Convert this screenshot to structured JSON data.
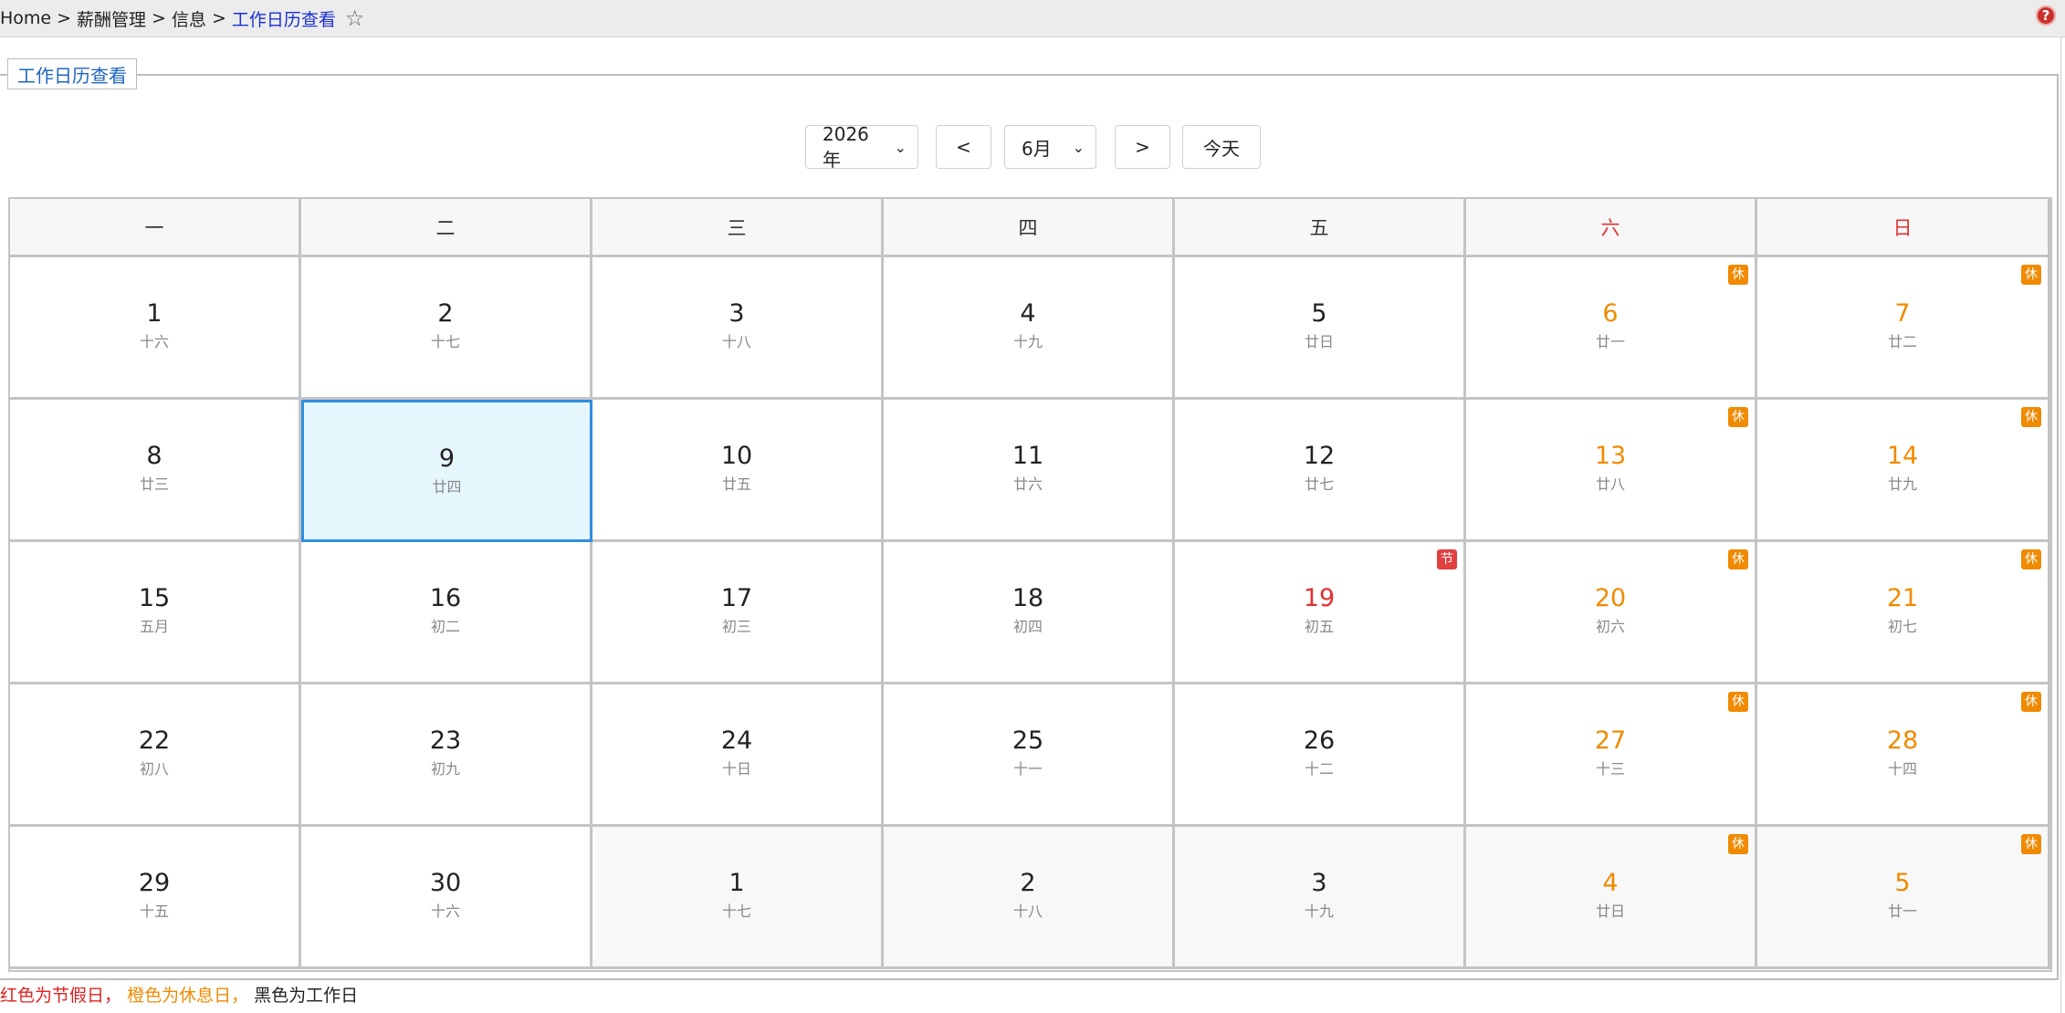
{
  "breadcrumb": {
    "items": [
      "Home",
      "薪酬管理",
      "信息"
    ],
    "separator": ">",
    "current": "工作日历查看",
    "favorite_icon": "star-outline-icon"
  },
  "help": {
    "icon": "help-icon",
    "glyph": "?"
  },
  "panel": {
    "legend": "工作日历查看"
  },
  "controls": {
    "year_value": "2026年",
    "prev_label": "<",
    "month_value": "6月",
    "next_label": ">",
    "today_label": "今天"
  },
  "weekdays": [
    "一",
    "二",
    "三",
    "四",
    "五",
    "六",
    "日"
  ],
  "weeks": [
    [
      {
        "day": "1",
        "lunar": "十六",
        "kind": "work"
      },
      {
        "day": "2",
        "lunar": "十七",
        "kind": "work"
      },
      {
        "day": "3",
        "lunar": "十八",
        "kind": "work"
      },
      {
        "day": "4",
        "lunar": "十九",
        "kind": "work"
      },
      {
        "day": "5",
        "lunar": "廿日",
        "kind": "work"
      },
      {
        "day": "6",
        "lunar": "廿一",
        "kind": "rest",
        "badge": "休"
      },
      {
        "day": "7",
        "lunar": "廿二",
        "kind": "rest",
        "badge": "休"
      }
    ],
    [
      {
        "day": "8",
        "lunar": "廿三",
        "kind": "work"
      },
      {
        "day": "9",
        "lunar": "廿四",
        "kind": "work",
        "today": true
      },
      {
        "day": "10",
        "lunar": "廿五",
        "kind": "work"
      },
      {
        "day": "11",
        "lunar": "廿六",
        "kind": "work"
      },
      {
        "day": "12",
        "lunar": "廿七",
        "kind": "work"
      },
      {
        "day": "13",
        "lunar": "廿八",
        "kind": "rest",
        "badge": "休"
      },
      {
        "day": "14",
        "lunar": "廿九",
        "kind": "rest",
        "badge": "休"
      }
    ],
    [
      {
        "day": "15",
        "lunar": "五月",
        "kind": "work"
      },
      {
        "day": "16",
        "lunar": "初二",
        "kind": "work"
      },
      {
        "day": "17",
        "lunar": "初三",
        "kind": "work"
      },
      {
        "day": "18",
        "lunar": "初四",
        "kind": "work"
      },
      {
        "day": "19",
        "lunar": "初五",
        "kind": "holiday",
        "badge": "节"
      },
      {
        "day": "20",
        "lunar": "初六",
        "kind": "rest",
        "badge": "休"
      },
      {
        "day": "21",
        "lunar": "初七",
        "kind": "rest",
        "badge": "休"
      }
    ],
    [
      {
        "day": "22",
        "lunar": "初八",
        "kind": "work"
      },
      {
        "day": "23",
        "lunar": "初九",
        "kind": "work"
      },
      {
        "day": "24",
        "lunar": "十日",
        "kind": "work"
      },
      {
        "day": "25",
        "lunar": "十一",
        "kind": "work"
      },
      {
        "day": "26",
        "lunar": "十二",
        "kind": "work"
      },
      {
        "day": "27",
        "lunar": "十三",
        "kind": "rest",
        "badge": "休"
      },
      {
        "day": "28",
        "lunar": "十四",
        "kind": "rest",
        "badge": "休"
      }
    ],
    [
      {
        "day": "29",
        "lunar": "十五",
        "kind": "work"
      },
      {
        "day": "30",
        "lunar": "十六",
        "kind": "work"
      },
      {
        "day": "1",
        "lunar": "十七",
        "kind": "work",
        "other": true
      },
      {
        "day": "2",
        "lunar": "十八",
        "kind": "work",
        "other": true
      },
      {
        "day": "3",
        "lunar": "十九",
        "kind": "work",
        "other": true
      },
      {
        "day": "4",
        "lunar": "廿日",
        "kind": "rest",
        "badge": "休",
        "other": true
      },
      {
        "day": "5",
        "lunar": "廿一",
        "kind": "rest",
        "badge": "休",
        "other": true
      }
    ]
  ],
  "legend_note": {
    "red": "红色为节假日，",
    "orange": "橙色为休息日，",
    "black": "黑色为工作日"
  },
  "colors": {
    "holiday": "#e03030",
    "rest": "#f08a00",
    "work": "#222222",
    "today_bg": "#e6f6fd",
    "today_border": "#2f8ee0",
    "link": "#1a2fd6"
  }
}
